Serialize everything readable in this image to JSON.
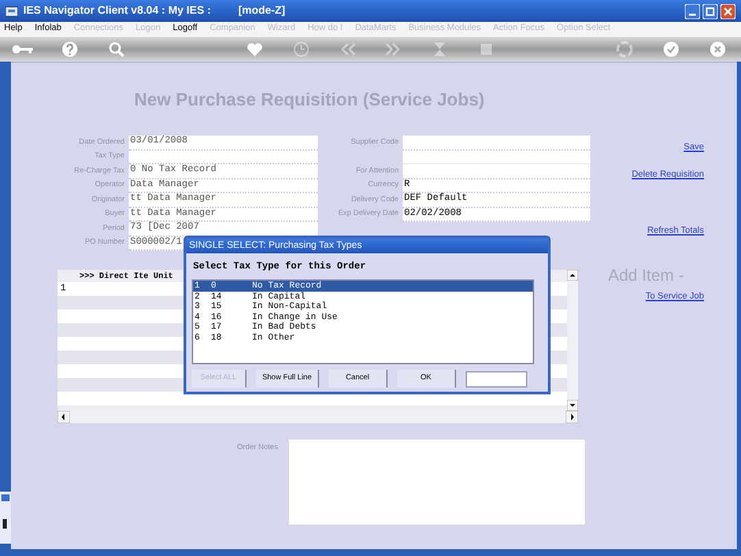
{
  "window": {
    "title": "IES Navigator Client v8.04 : My IES :",
    "mode": "[mode-Z]"
  },
  "menu": [
    {
      "label": "Help",
      "disabled": false
    },
    {
      "label": "Infolab",
      "disabled": false
    },
    {
      "label": "Connections",
      "disabled": true
    },
    {
      "label": "Logon",
      "disabled": true
    },
    {
      "label": "Logoff",
      "disabled": false
    },
    {
      "label": "Companion",
      "disabled": true
    },
    {
      "label": "Wizard",
      "disabled": true
    },
    {
      "label": "How do I",
      "disabled": true
    },
    {
      "label": "DataMarts",
      "disabled": true
    },
    {
      "label": "Business Modules",
      "disabled": true
    },
    {
      "label": "Action Focus",
      "disabled": true
    },
    {
      "label": "Option Select",
      "disabled": true
    }
  ],
  "toolbar": [
    {
      "kind": "key",
      "disabled": false
    },
    {
      "kind": "help",
      "disabled": false
    },
    {
      "kind": "search",
      "disabled": false
    },
    {
      "kind": "heart",
      "disabled": false
    },
    {
      "kind": "clock",
      "disabled": true
    },
    {
      "kind": "back",
      "disabled": true
    },
    {
      "kind": "forward",
      "disabled": true
    },
    {
      "kind": "hourglass",
      "disabled": true
    },
    {
      "kind": "stop",
      "disabled": true
    },
    {
      "kind": "recycle",
      "disabled": true
    },
    {
      "kind": "check",
      "disabled": false
    },
    {
      "kind": "close",
      "disabled": false
    }
  ],
  "form": {
    "heading": "New Purchase Requisition (Service Jobs)",
    "left_fields": [
      {
        "label": "Date Ordered",
        "value": "03/01/2008"
      },
      {
        "label": "Tax Type"
      },
      {
        "label": "Re-Charge Tax",
        "value": "0 No Tax Record"
      },
      {
        "label": "Operator",
        "value": "Data Manager"
      },
      {
        "label": "Originator",
        "value": "tt Data Manager"
      },
      {
        "label": "Buyer",
        "value": "tt Data Manager"
      },
      {
        "label": "Period",
        "value": "73  [Dec 2007"
      },
      {
        "label": "PO Number",
        "value": "S000002/1"
      }
    ],
    "right_fields": [
      {
        "label": "Supplier Code"
      },
      {
        "kind": "unlabeled"
      },
      {
        "label": "For Attention"
      },
      {
        "label": "Currency",
        "value": "R"
      },
      {
        "label": "Delivery Code",
        "value": "DEF Default"
      },
      {
        "label": "Exp Delivery Date",
        "value": "02/02/2008"
      }
    ]
  },
  "links": [
    {
      "kind": "link",
      "label": "Save"
    },
    {
      "kind": "link",
      "label": "Delete Requisition"
    },
    {
      "kind": "link",
      "label": "Refresh Totals"
    },
    {
      "kind": "heading",
      "label": "Add Item -"
    },
    {
      "kind": "link",
      "label": "To Service Job"
    }
  ],
  "grid": {
    "header": ">>> Direct Ite Unit",
    "row_numbers": [
      "1"
    ]
  },
  "notes": {
    "label": "Order Notes"
  },
  "dialog": {
    "title": "SINGLE SELECT: Purchasing Tax Types",
    "prompt": "Select Tax Type for this Order",
    "rows": [
      {
        "num": "1",
        "code": "0",
        "name": "No Tax Record",
        "selected": true
      },
      {
        "num": "2",
        "code": "14",
        "name": "In Capital",
        "selected": false
      },
      {
        "num": "3",
        "code": "15",
        "name": "In Non-Capital",
        "selected": false
      },
      {
        "num": "4",
        "code": "16",
        "name": "In Change in Use",
        "selected": false
      },
      {
        "num": "5",
        "code": "17",
        "name": "In Bad Debts",
        "selected": false
      },
      {
        "num": "6",
        "code": "18",
        "name": "In Other",
        "selected": false
      }
    ],
    "buttons": [
      {
        "label": "Select ALL",
        "disabled": true
      },
      {
        "label": "Show Full Line",
        "disabled": false
      },
      {
        "label": "Cancel",
        "disabled": false
      },
      {
        "label": "OK",
        "disabled": false
      }
    ]
  }
}
